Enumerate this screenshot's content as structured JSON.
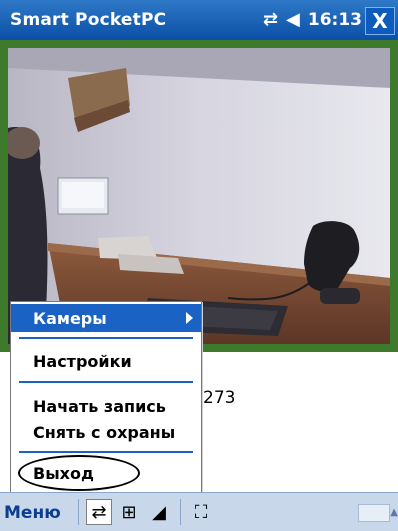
{
  "titlebar": {
    "title": "Smart PocketPC",
    "time": "16:13",
    "icons": [
      "connectivity-icon",
      "volume-icon"
    ],
    "close_label": "X"
  },
  "main": {
    "info_text": "273"
  },
  "popup_menu": {
    "items": [
      {
        "label": "Камеры",
        "has_submenu": true,
        "selected": true
      },
      {
        "label": "Настройки"
      },
      {
        "label": "Начать запись"
      },
      {
        "label": "Снять с охраны"
      },
      {
        "label": "Выход"
      }
    ]
  },
  "menubar": {
    "menu_label": "Меню",
    "tools": [
      "swap-arrows-icon",
      "fit-screen-icon",
      "signal-icon",
      "fullscreen-icon",
      "keyboard-icon"
    ]
  },
  "colors": {
    "titlebar": "#0a4fa5",
    "accent": "#1a63c4",
    "frame": "#3e7a2c",
    "menubar": "#c8d7ea"
  }
}
